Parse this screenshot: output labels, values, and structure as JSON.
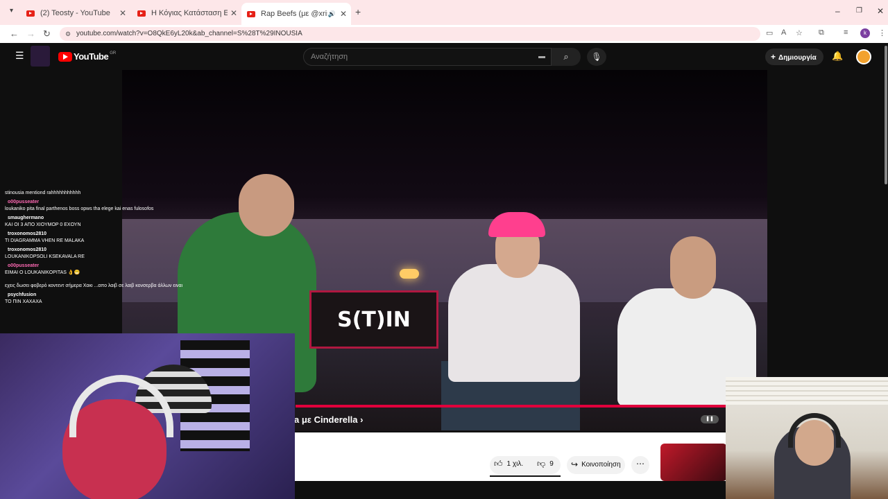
{
  "browser": {
    "tabs": [
      {
        "title": "(2) Teosty - YouTube"
      },
      {
        "title": "Η Κόγιας Κατάσταση Είναι Τρ..."
      },
      {
        "title": "Rap Beefs (με @xristt)) CHI..."
      }
    ],
    "url": "youtube.com/watch?v=O8QkE6yL20k&ab_channel=S%28T%29INOUSIA"
  },
  "youtube": {
    "logo_text": "YouTube",
    "region": "GR",
    "search_placeholder": "Αναζήτηση",
    "create_label": "Δημιουργία",
    "video_title_fragment": "a με Cinderella",
    "sign_text": "S(T)IN",
    "likes": "1 χιλ.",
    "dislikes": "9",
    "share_label": "Κοινοποίηση"
  },
  "chat": {
    "messages": [
      {
        "user": "",
        "text": "stinousia mentiond rahhhhhhhhhhh",
        "color": "#3d5afe"
      },
      {
        "user": "o00pusseater",
        "text": "loukaniko pita final parthenos boss opws tha elege kai enas fulosofos",
        "color": "#ff69b4"
      },
      {
        "user": "smaughermano",
        "text": "ΚΑΙ ΟΙ 3 ΑΠΟ ΧΙΟΥΜΟΡ 0 ΕΧΟΥΝ",
        "color": "#ffffff"
      },
      {
        "user": "troxonomos2810",
        "text": "TI DIAGRAMMA VHEN RE MALAKA",
        "color": "#ffffff"
      },
      {
        "user": "troxonomos2810",
        "text": "LOUKANIKOPSOLI KSEKAVALA RE",
        "color": "#ffffff"
      },
      {
        "user": "o00pusseater",
        "text": "EIMAI O LOUKANIKOPITAS 👌😁",
        "color": "#ff69b4"
      },
      {
        "user": "",
        "text": "εχεις δωσει φοβερό κοντεντ σήμερα Χακι ...απο λαιβ σε λαιβ κονσερβα άλλων ειναι",
        "color": "#3d5afe"
      },
      {
        "user": "psychfusion",
        "text": "ΤΟ ΠΙΝ ΧΑΧΑΧΑ",
        "color": "#ffffff"
      }
    ]
  },
  "colors": {
    "yt_red": "#ff0000",
    "progress": "#e0003c",
    "tab_bg": "#fde7e9"
  }
}
